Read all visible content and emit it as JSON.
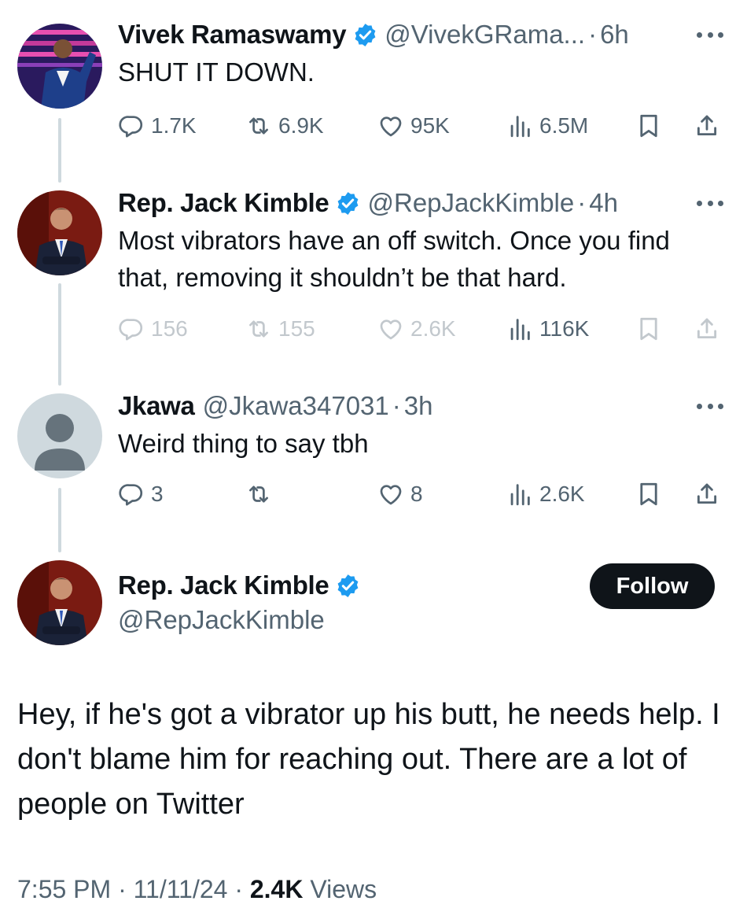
{
  "tweets": [
    {
      "name": "Vivek Ramaswamy",
      "handle": "@VivekGRama...",
      "sep": "·",
      "time": "6h",
      "text": "SHUT IT DOWN.",
      "replies": "1.7K",
      "retweets": "6.9K",
      "likes": "95K",
      "views": "6.5M"
    },
    {
      "name": "Rep. Jack Kimble",
      "handle": "@RepJackKimble",
      "sep": "·",
      "time": "4h",
      "text": "Most vibrators have an off switch. Once you find that, removing it shouldn’t be that hard.",
      "replies": "156",
      "retweets": "155",
      "likes": "2.6K",
      "views": "116K"
    },
    {
      "name": "Jkawa",
      "handle": "@Jkawa347031",
      "sep": "·",
      "time": "3h",
      "text": "Weird thing to say tbh",
      "replies": "3",
      "retweets": "",
      "likes": "8",
      "views": "2.6K"
    }
  ],
  "main": {
    "name": "Rep. Jack Kimble",
    "handle": "@RepJackKimble",
    "follow_label": "Follow",
    "text": "Hey, if he's got a vibrator up his butt, he needs help.  I don't blame him for reaching out. There are a lot of people on Twitter",
    "time": "7:55 PM",
    "sep1": "·",
    "date": "11/11/24",
    "sep2": "·",
    "views": "2.4K",
    "views_label": "Views"
  },
  "colors": {
    "verified": "#1d9bf0",
    "muted": "#536471",
    "text": "#0f1419",
    "thread_line": "#cfd9de"
  },
  "icons": [
    "reply-icon",
    "retweet-icon",
    "like-icon",
    "views-icon",
    "bookmark-icon",
    "share-icon",
    "more-icon",
    "verified-badge-icon"
  ]
}
